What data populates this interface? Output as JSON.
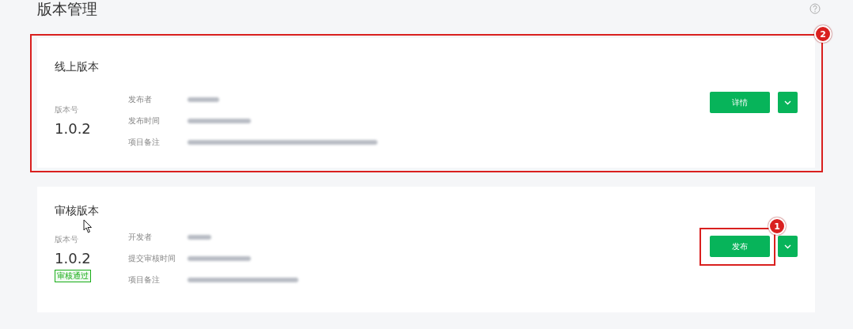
{
  "page_title": "版本管理",
  "sections": [
    {
      "title": "线上版本",
      "version_label": "版本号",
      "version": "1.0.2",
      "fields": [
        {
          "label": "发布者"
        },
        {
          "label": "发布时间"
        },
        {
          "label": "项目备注"
        }
      ],
      "button": "详情",
      "annotation": {
        "kind": "card",
        "badge": "2"
      }
    },
    {
      "title": "审核版本",
      "version_label": "版本号",
      "version": "1.0.2",
      "status_tag": "审核通过",
      "fields": [
        {
          "label": "开发者"
        },
        {
          "label": "提交审核时间"
        },
        {
          "label": "项目备注"
        }
      ],
      "button": "发布",
      "annotation": {
        "kind": "button",
        "badge": "1"
      }
    }
  ]
}
